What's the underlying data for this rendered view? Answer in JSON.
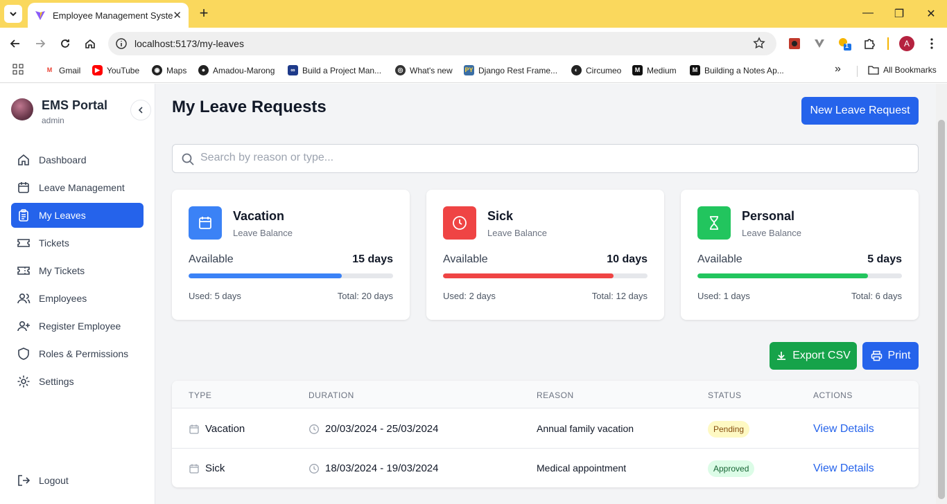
{
  "browser": {
    "tab_title": "Employee Management System",
    "url": "localhost:5173/my-leaves",
    "profile_initial": "A",
    "extension_badge": "1",
    "bookmarks": [
      "Gmail",
      "YouTube",
      "Maps",
      "Amadou-Marong",
      "Build a Project Man...",
      "What's new",
      "Django Rest Frame...",
      "Circumeo",
      "Medium",
      "Building a Notes Ap..."
    ],
    "all_bookmarks": "All Bookmarks"
  },
  "sidebar": {
    "brand": "EMS Portal",
    "role": "admin",
    "items": [
      {
        "label": "Dashboard",
        "icon": "home-icon"
      },
      {
        "label": "Leave Management",
        "icon": "calendar-icon"
      },
      {
        "label": "My Leaves",
        "icon": "clipboard-icon",
        "active": true
      },
      {
        "label": "Tickets",
        "icon": "ticket-icon"
      },
      {
        "label": "My Tickets",
        "icon": "ticket-icon"
      },
      {
        "label": "Employees",
        "icon": "users-icon"
      },
      {
        "label": "Register Employee",
        "icon": "user-plus-icon"
      },
      {
        "label": "Roles & Permissions",
        "icon": "shield-icon"
      },
      {
        "label": "Settings",
        "icon": "gear-icon"
      }
    ],
    "logout": "Logout"
  },
  "main": {
    "title": "My Leave Requests",
    "new_request": "New Leave Request",
    "search_placeholder": "Search by reason or type...",
    "export_csv": "Export CSV",
    "print": "Print",
    "cards": [
      {
        "type": "Vacation",
        "subtitle": "Leave Balance",
        "available_label": "Available",
        "available": "15 days",
        "used": "Used: 5 days",
        "total": "Total: 20 days",
        "fraction": 0.75,
        "color": "#3b82f6",
        "icon": "calendar-icon"
      },
      {
        "type": "Sick",
        "subtitle": "Leave Balance",
        "available_label": "Available",
        "available": "10 days",
        "used": "Used: 2 days",
        "total": "Total: 12 days",
        "fraction": 0.833,
        "color": "#ef4444",
        "icon": "clock-icon"
      },
      {
        "type": "Personal",
        "subtitle": "Leave Balance",
        "available_label": "Available",
        "available": "5 days",
        "used": "Used: 1 days",
        "total": "Total: 6 days",
        "fraction": 0.833,
        "color": "#22c55e",
        "icon": "hourglass-icon"
      }
    ],
    "table": {
      "headers": [
        "TYPE",
        "DURATION",
        "REASON",
        "STATUS",
        "ACTIONS"
      ],
      "rows": [
        {
          "type": "Vacation",
          "duration": "20/03/2024 - 25/03/2024",
          "reason": "Annual family vacation",
          "status": "Pending",
          "action": "View Details"
        },
        {
          "type": "Sick",
          "duration": "18/03/2024 - 19/03/2024",
          "reason": "Medical appointment",
          "status": "Approved",
          "action": "View Details"
        }
      ]
    }
  }
}
